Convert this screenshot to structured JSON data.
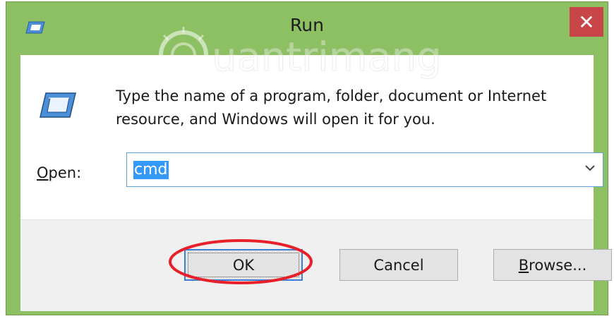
{
  "window": {
    "title": "Run",
    "close_glyph": "✕"
  },
  "dialog": {
    "description": "Type the name of a program, folder, document or Internet resource, and Windows will open it for you.",
    "open_label_mnemonic": "O",
    "open_label_rest": "pen:",
    "open_value": "cmd"
  },
  "buttons": {
    "ok_label": "OK",
    "cancel_label": "Cancel",
    "browse_mnemonic": "B",
    "browse_rest": "rowse..."
  },
  "watermark": {
    "text": "uantrimang"
  },
  "colors": {
    "titlebar": "#8cc063",
    "close_button": "#c8464a",
    "selection": "#3399ff",
    "annotation": "#e8202a",
    "focus_border": "#3c7fd6"
  },
  "icons": {
    "title": "run-icon",
    "dialog": "run-icon",
    "dropdown": "chevron-down-icon",
    "close": "close-icon"
  }
}
